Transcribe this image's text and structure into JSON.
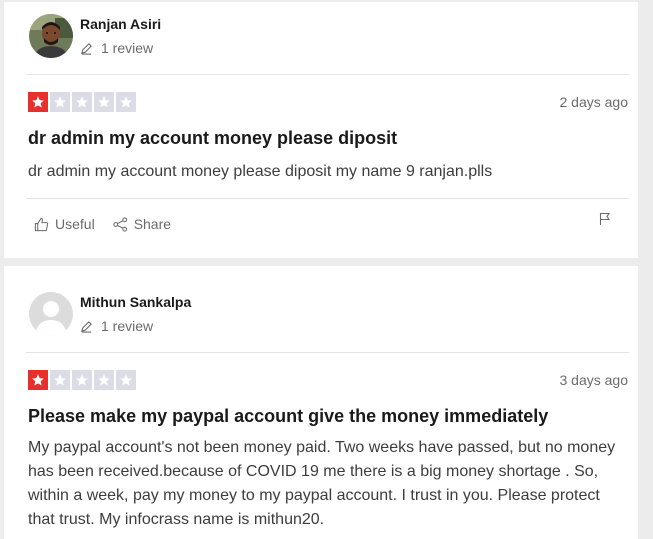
{
  "reviews": [
    {
      "author": "Ranjan Asiri",
      "review_count": "1 review",
      "rating": 1,
      "max_rating": 5,
      "date": "2 days ago",
      "title": "dr admin my account money please diposit",
      "body": "dr admin my account money please diposit my name 9 ranjan.plls",
      "useful_label": "Useful",
      "share_label": "Share"
    },
    {
      "author": "Mithun Sankalpa",
      "review_count": "1 review",
      "rating": 1,
      "max_rating": 5,
      "date": "3 days ago",
      "title": "Please make my paypal account give the money immediately",
      "body": "My paypal account's not been money paid. Two weeks have passed, but no money has been received.because of COVID 19 me there is a big money shortage . So, within a week, pay my money to my paypal account. I trust in you. Please protect that trust. My infocrass name is mithun20."
    }
  ],
  "colors": {
    "star_on": "#e5302d",
    "star_off": "#dcdce6",
    "muted_text": "#6b6b6b"
  },
  "icons": {
    "pencil": "pencil-icon",
    "thumbs_up": "thumbs-up-icon",
    "share": "share-icon",
    "flag": "flag-icon"
  }
}
